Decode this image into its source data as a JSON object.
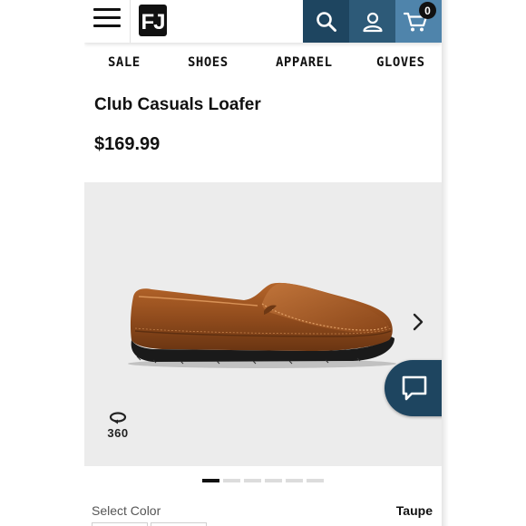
{
  "header": {
    "menu_icon": "hamburger-menu-icon",
    "logo_text": "FJ",
    "search_icon": "search-icon",
    "account_icon": "user-icon",
    "cart_icon": "cart-icon",
    "cart_count": "0",
    "colors": {
      "search_bg": "#1e4560",
      "account_bg": "#2d5a78",
      "cart_bg": "#4f84ab"
    }
  },
  "nav": {
    "items": [
      {
        "label": "SALE"
      },
      {
        "label": "SHOES"
      },
      {
        "label": "APPAREL"
      },
      {
        "label": "GLOVES"
      }
    ]
  },
  "product": {
    "title": "Club Casuals Loafer",
    "price": "$169.99"
  },
  "gallery": {
    "next_icon": "chevron-right-icon",
    "view360_icon": "rotate-360-icon",
    "view360_label": "360",
    "slide_count": 6,
    "active_slide": 1
  },
  "chat": {
    "icon": "chat-bubble-icon",
    "color": "#1e4560"
  },
  "color_select": {
    "label": "Select Color",
    "value": "Taupe"
  }
}
